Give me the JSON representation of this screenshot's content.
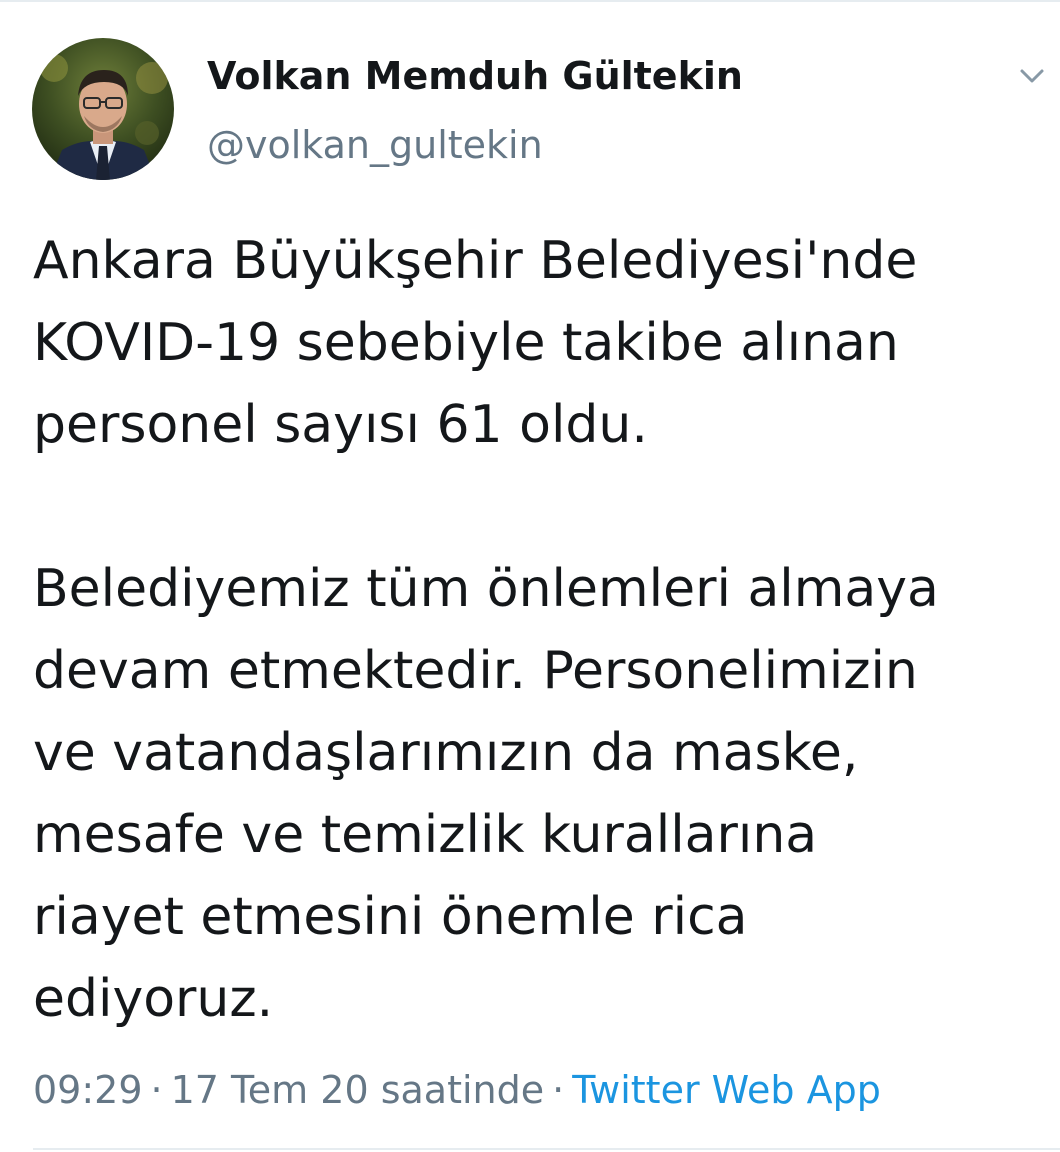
{
  "author": {
    "display_name": "Volkan Memduh Gültekin",
    "handle": "@volkan_gultekin"
  },
  "tweet": {
    "paragraph_1": "Ankara Büyükşehir Belediyesi'nde\nKOVID-19 sebebiyle takibe alınan\npersonel sayısı 61 oldu.",
    "paragraph_2": "Belediyemiz tüm önlemleri almaya\ndevam etmektedir. Personelimizin\nve vatandaşlarımızın da maske,\nmesafe ve temizlik kurallarına\nriayet etmesini önemle rica\nediyoruz."
  },
  "meta": {
    "time": "09:29",
    "separator": "·",
    "date": "17 Tem 20 saatinde",
    "source": "Twitter Web App"
  },
  "icons": {
    "menu": "chevron-down-icon",
    "avatar": "avatar"
  },
  "colors": {
    "text": "#14171a",
    "secondary": "#657786",
    "link": "#1b95e0"
  }
}
